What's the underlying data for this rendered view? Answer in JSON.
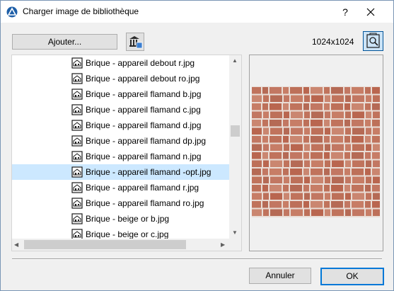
{
  "window": {
    "title": "Charger image de bibliothèque",
    "help_label": "?"
  },
  "toolbar": {
    "add_label": "Ajouter...",
    "dimensions": "1024x1024"
  },
  "file_list": {
    "items": [
      {
        "label": "Brique - appareil debout r.jpg",
        "selected": false
      },
      {
        "label": "Brique - appareil debout ro.jpg",
        "selected": false
      },
      {
        "label": "Brique - appareil flamand b.jpg",
        "selected": false
      },
      {
        "label": "Brique - appareil flamand c.jpg",
        "selected": false
      },
      {
        "label": "Brique - appareil flamand d.jpg",
        "selected": false
      },
      {
        "label": "Brique - appareil flamand dp.jpg",
        "selected": false
      },
      {
        "label": "Brique - appareil flamand n.jpg",
        "selected": false
      },
      {
        "label": "Brique - appareil flamand -opt.jpg",
        "selected": true
      },
      {
        "label": "Brique - appareil flamand r.jpg",
        "selected": false
      },
      {
        "label": "Brique - appareil flamand ro.jpg",
        "selected": false
      },
      {
        "label": "Brique - beige or b.jpg",
        "selected": false
      },
      {
        "label": "Brique - beige or c.jpg",
        "selected": false
      }
    ]
  },
  "footer": {
    "cancel_label": "Annuler",
    "ok_label": "OK"
  },
  "colors": {
    "selection": "#cce8ff",
    "brick": "#c0735c",
    "mortar": "#e9ddd6",
    "accent": "#0078d7"
  },
  "icons": {
    "app": "archicad-logo-icon",
    "library": "library-building-icon",
    "preview": "preview-magnify-icon",
    "file": "image-file-icon"
  }
}
